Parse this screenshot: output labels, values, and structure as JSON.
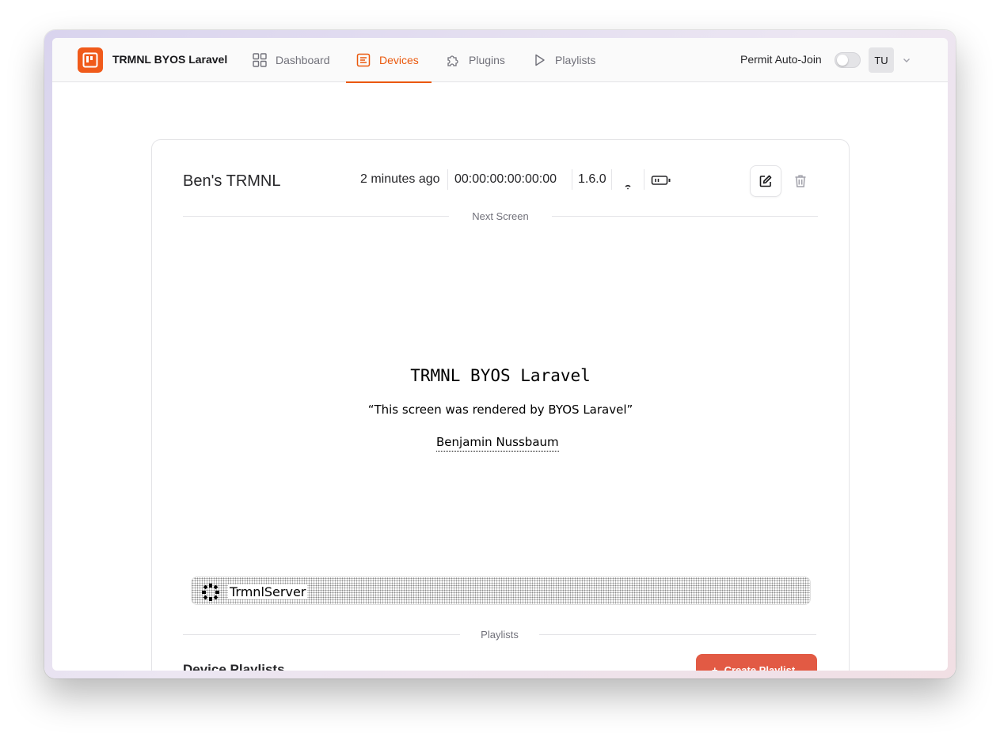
{
  "app": {
    "brand": "TRMNL BYOS Laravel",
    "accent": "#ea580c"
  },
  "nav": {
    "items": [
      {
        "label": "Dashboard",
        "icon": "grid-icon"
      },
      {
        "label": "Devices",
        "icon": "list-icon",
        "active": true
      },
      {
        "label": "Plugins",
        "icon": "puzzle-icon"
      },
      {
        "label": "Playlists",
        "icon": "play-icon"
      }
    ]
  },
  "header": {
    "auto_join_label": "Permit Auto-Join",
    "auto_join_enabled": false,
    "user_initials": "TU"
  },
  "device": {
    "name": "Ben's TRMNL",
    "last_seen": "2 minutes ago",
    "mac": "00:00:00:00:00:00",
    "firmware": "1.6.0",
    "wifi_icon": "wifi-icon",
    "battery_icon": "battery-icon"
  },
  "sections": {
    "next_screen": "Next Screen",
    "playlists": "Playlists"
  },
  "screen": {
    "title": "TRMNL BYOS Laravel",
    "quote": "“This screen was rendered by BYOS Laravel”",
    "author": "Benjamin Nussbaum",
    "title_bar": "TrmnlServer"
  },
  "playlists": {
    "heading": "Device Playlists",
    "create_label": "Create Playlist"
  }
}
